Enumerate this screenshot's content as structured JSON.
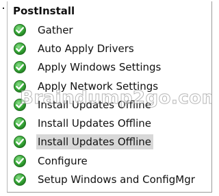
{
  "group": {
    "title": "PostInstall"
  },
  "steps": [
    {
      "label": "Gather",
      "icon": "green-check-icon",
      "selected": false
    },
    {
      "label": "Auto Apply Drivers",
      "icon": "green-check-icon",
      "selected": false
    },
    {
      "label": "Apply Windows Settings",
      "icon": "green-check-icon",
      "selected": false
    },
    {
      "label": "Apply Network Settings",
      "icon": "green-check-icon",
      "selected": false
    },
    {
      "label": "Install Updates Offline",
      "icon": "green-check-icon",
      "selected": false
    },
    {
      "label": "Install Updates Offline",
      "icon": "green-check-icon",
      "selected": false
    },
    {
      "label": "Install Updates Offline",
      "icon": "green-check-icon",
      "selected": true
    },
    {
      "label": "Configure",
      "icon": "green-check-icon",
      "selected": false
    },
    {
      "label": "Setup Windows and ConfigMgr",
      "icon": "green-check-icon",
      "selected": false
    }
  ],
  "watermark": {
    "text": "Braindump2go.com"
  },
  "colors": {
    "check_green": "#2e9a2e",
    "selection": "#d8d8d8"
  }
}
